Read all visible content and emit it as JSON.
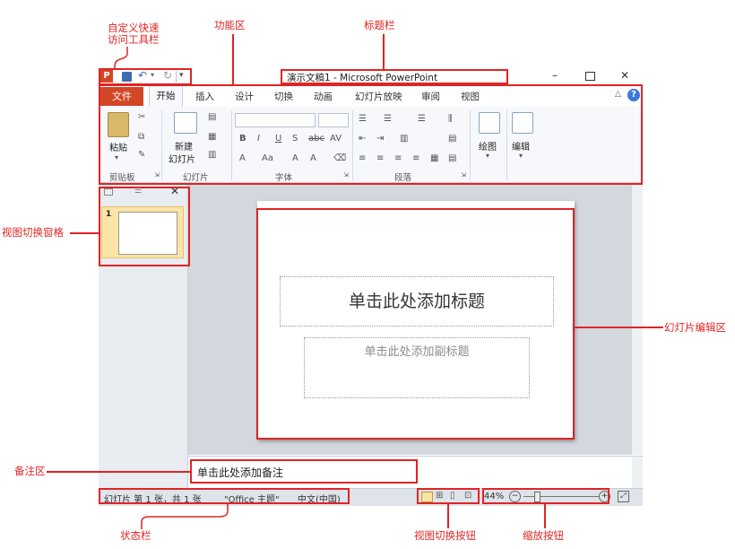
{
  "annotations": {
    "qat_line1": "自定义快速",
    "qat_line2": "访问工具栏",
    "ribbon": "功能区",
    "titlebar": "标题栏",
    "view_pane": "视图切换窗格",
    "slide_edit": "幻灯片编辑区",
    "notes_area": "备注区",
    "status_bar": "状态栏",
    "view_buttons": "视图切换按钮",
    "zoom_buttons": "缩放按钮"
  },
  "window": {
    "title": "演示文稿1 - Microsoft PowerPoint",
    "app_icon": "P",
    "minimize": "–",
    "maximize": "☐",
    "close": "✕"
  },
  "tabs": {
    "file": "文件",
    "home": "开始",
    "insert": "插入",
    "design": "设计",
    "transitions": "切换",
    "animations": "动画",
    "slideshow": "幻灯片放映",
    "review": "审阅",
    "view": "视图"
  },
  "ribbon": {
    "paste": "粘贴",
    "new_slide_1": "新建",
    "new_slide_2": "幻灯片",
    "drawing": "绘图",
    "editing": "编辑",
    "groups": {
      "clipboard": "剪贴板",
      "slides": "幻灯片",
      "font": "字体",
      "paragraph": "段落"
    }
  },
  "slide_pane": {
    "slide_number": "1"
  },
  "slide": {
    "title_placeholder": "单击此处添加标题",
    "subtitle_placeholder": "单击此处添加副标题"
  },
  "notes": {
    "placeholder": "单击此处添加备注"
  },
  "status": {
    "slide_info": "幻灯片 第 1 张，共 1 张",
    "theme": "\"Office 主题\"",
    "language": "中文(中国)",
    "zoom": "44%"
  },
  "colors": {
    "annotation_red": "#e02424",
    "file_tab": "#d24726"
  }
}
